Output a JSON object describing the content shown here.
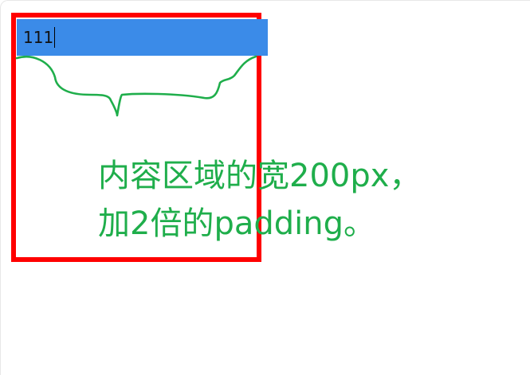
{
  "input": {
    "value": "111"
  },
  "annotation": {
    "line1": "内容区域的宽200px，",
    "line2": "加2倍的padding。"
  },
  "colors": {
    "border": "#ff0000",
    "input_background": "#3b8be8",
    "annotation": "#1fae4b"
  }
}
